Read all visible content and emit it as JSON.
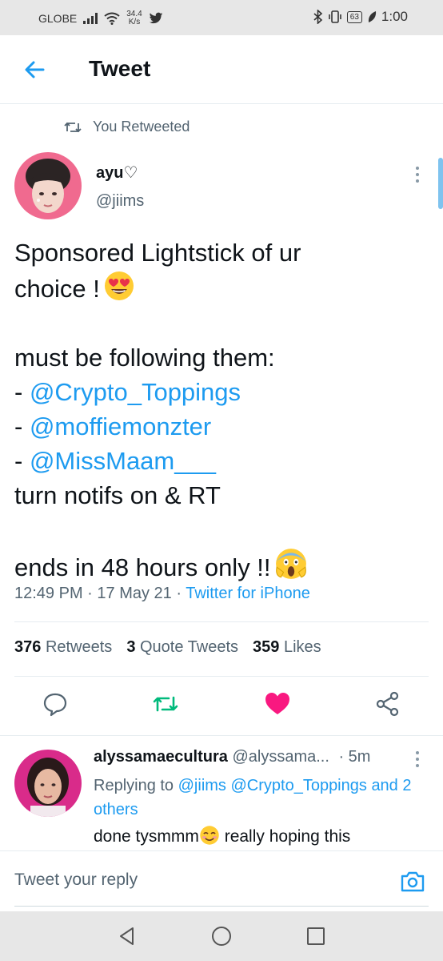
{
  "status_bar": {
    "carrier": "GLOBE",
    "speed_value": "34.4",
    "speed_unit": "K/s",
    "battery": "63",
    "time": "1:00"
  },
  "header": {
    "title": "Tweet"
  },
  "retweet_label": "You Retweeted",
  "tweet": {
    "author_name": "ayu♡",
    "author_handle": "@jiims",
    "line1": "Sponsored Lightstick of ur",
    "line2": "choice !",
    "line3": "must be following them:",
    "mentions": [
      "@Crypto_Toppings",
      "@moffiemonzter",
      "@MissMaam___"
    ],
    "dash": "- ",
    "line4": "turn notifs on & RT",
    "line5": "ends in 48 hours only !!",
    "time": "12:49 PM",
    "date": "17 May 21",
    "source": "Twitter for iPhone",
    "retweets_count": "376",
    "retweets_label": "Retweets",
    "quotes_count": "3",
    "quotes_label": "Quote Tweets",
    "likes_count": "359",
    "likes_label": "Likes"
  },
  "reply": {
    "name": "alyssamaecultura",
    "handle": "@alyssama...",
    "age": "· 5m",
    "replying_prefix": "Replying to",
    "replying_to": [
      "@jiims",
      "@Crypto_Toppings"
    ],
    "and_others": "and 2 others",
    "text_start": "done tysmmm",
    "text_end": " really hoping this"
  },
  "compose": {
    "placeholder": "Tweet your reply"
  },
  "colors": {
    "accent": "#1d9bf0",
    "retweet": "#00ba7c",
    "like": "#f91880"
  },
  "icons": [
    "back-arrow-icon",
    "retweet-icon",
    "more-vertical-icon",
    "reply-icon",
    "share-icon",
    "camera-icon",
    "heart-icon"
  ]
}
